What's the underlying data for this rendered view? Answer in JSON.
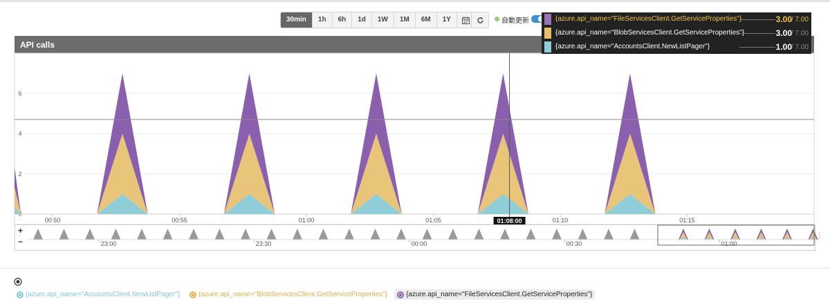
{
  "toolbar": {
    "ranges": [
      "30min",
      "1h",
      "6h",
      "1d",
      "1W",
      "1M",
      "6M",
      "1Y"
    ],
    "active_range": "30min",
    "live_label": "自動更新",
    "live_enabled": true
  },
  "chart_title": "API calls",
  "crosshair_time": "01:08:00",
  "tooltip": {
    "rows": [
      {
        "name": "{azure.api_name=\"FileServicesClient.GetServiceProperties\"}",
        "value": "3.00",
        "total": "/ 7.00",
        "color": "#9b74b8",
        "highlight": true
      },
      {
        "name": "{azure.api_name=\"BlobServicesClient.GetServiceProperties\"}",
        "value": "3.00",
        "total": "/ 7.00",
        "color": "#e8c06a",
        "highlight": false
      },
      {
        "name": "{azure.api_name=\"AccountsClient.NewListPager\"}",
        "value": "1.00",
        "total": "/ 7.00",
        "color": "#8fcdd8",
        "highlight": false
      }
    ]
  },
  "navigator": {
    "tick_labels": [
      "23:00",
      "23:30",
      "00:00",
      "00:30",
      "01:00"
    ]
  },
  "legend": [
    {
      "label": "{azure.api_name=\"AccountsClient.NewListPager\"}",
      "color": "#7fc7d6",
      "selected": false
    },
    {
      "label": "{azure.api_name=\"BlobServicesClient.GetServiceProperties\"}",
      "color": "#e2b048",
      "selected": false
    },
    {
      "label": "{azure.api_name=\"FileServicesClient.GetServiceProperties\"}",
      "color": "#8a5fae",
      "selected": true
    }
  ],
  "chart_data": {
    "type": "area",
    "stacked": true,
    "title": "API calls",
    "x_range": [
      "00:48:30",
      "01:20:00"
    ],
    "ylim": [
      0,
      8
    ],
    "y_ticks": [
      0,
      2,
      4,
      6
    ],
    "x_ticks": [
      "00:50",
      "00:55",
      "01:00",
      "01:05",
      "01:10",
      "01:15"
    ],
    "x": [
      "00:48:00",
      "00:48:45",
      "00:51:45",
      "00:52:45",
      "00:53:45",
      "00:56:45",
      "00:57:45",
      "00:58:45",
      "01:01:45",
      "01:02:45",
      "01:03:45",
      "01:06:45",
      "01:07:45",
      "01:08:45",
      "01:11:45",
      "01:12:45",
      "01:13:45",
      "01:17:00"
    ],
    "series": [
      {
        "name": "{azure.api_name=\"AccountsClient.NewListPager\"}",
        "color": "#8fcdd8",
        "values": [
          1,
          0,
          0,
          1,
          0,
          0,
          1,
          0,
          0,
          1,
          0,
          0,
          1,
          0,
          0,
          1,
          0,
          0
        ]
      },
      {
        "name": "{azure.api_name=\"BlobServicesClient.GetServiceProperties\"}",
        "color": "#e8c578",
        "values": [
          3,
          0,
          0,
          3,
          0,
          0,
          3,
          0,
          0,
          3,
          0,
          0,
          3,
          0,
          0,
          3,
          0,
          0
        ]
      },
      {
        "name": "{azure.api_name=\"FileServicesClient.GetServiceProperties\"}",
        "color": "#8a5fae",
        "values": [
          3,
          0,
          0,
          3,
          0,
          0,
          3,
          0,
          0,
          3,
          0,
          0,
          3,
          0,
          0,
          3,
          0,
          0
        ]
      }
    ]
  }
}
